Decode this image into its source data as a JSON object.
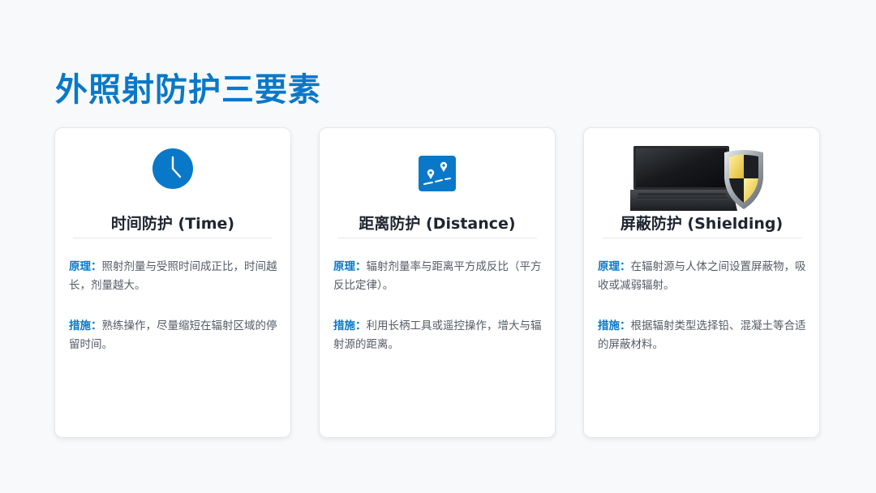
{
  "title": "外照射防护三要素",
  "colors": {
    "accent": "#0a78c8",
    "text": "#555b66",
    "heading": "#1f2530",
    "background": "#f7f9fb"
  },
  "cards": [
    {
      "icon": "clock-icon",
      "title": "时间防护 (Time)",
      "principle_label": "原理：",
      "principle_text": "照射剂量与受照时间成正比，时间越长，剂量越大。",
      "measure_label": "措施：",
      "measure_text": "熟练操作，尽量缩短在辐射区域的停留时间。"
    },
    {
      "icon": "distance-icon",
      "title": "距离防护 (Distance)",
      "principle_label": "原理：",
      "principle_text": "辐射剂量率与距离平方成反比（平方反比定律）。",
      "measure_label": "措施：",
      "measure_text": "利用长柄工具或遥控操作，增大与辐射源的距离。"
    },
    {
      "icon": "laptop-shield-icon",
      "title": "屏蔽防护 (Shielding)",
      "principle_label": "原理：",
      "principle_text": "在辐射源与人体之间设置屏蔽物，吸收或减弱辐射。",
      "measure_label": "措施：",
      "measure_text": "根据辐射类型选择铅、混凝土等合适的屏蔽材料。"
    }
  ]
}
